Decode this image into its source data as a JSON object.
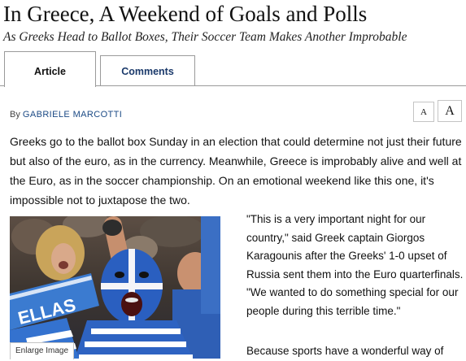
{
  "article": {
    "headline": "In Greece, A Weekend of Goals and Polls",
    "dek": "As Greeks Head to Ballot Boxes, Their Soccer Team Makes Another Improbable",
    "byline_prefix": "By",
    "author": "GABRIELE MARCOTTI",
    "intro": "Greeks go to the ballot box Sunday in an election that could determine not just their future but also of the euro, as in the currency. Meanwhile, Greece is improbably alive and well at the Euro, as in the soccer championship. On an emotional weekend like this one, it's impossible not to juxtapose the two.",
    "quote_paragraph": "\"This is a very important night for our country,\" said Greek captain Giorgos Karagounis after the Greeks' 1-0 upset of Russia sent them into the Euro quarterfinals. \"We wanted to do something special for our people during this terrible time.\"",
    "next_paragraph": "Because sports have a wonderful way of"
  },
  "tabs": [
    {
      "label": "Article",
      "active": true
    },
    {
      "label": "Comments",
      "active": false
    }
  ],
  "font_size_controls": {
    "small_label": "A",
    "large_label": "A"
  },
  "photo": {
    "enlarge_label": "Enlarge Image",
    "scarf_text": "ELLAS"
  },
  "colors": {
    "link_blue": "#1b4a85",
    "greek_blue": "#1f5fb8",
    "tab_border": "#9a9a9a"
  }
}
